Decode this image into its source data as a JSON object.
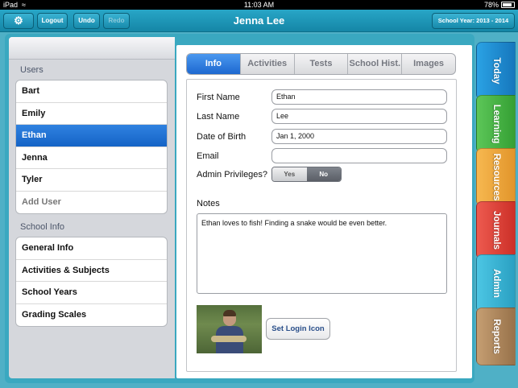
{
  "status_bar": {
    "carrier": "iPad",
    "time": "11:03 AM",
    "battery": "78%"
  },
  "nav": {
    "logout": "Logout",
    "undo": "Undo",
    "redo": "Redo",
    "title": "Jenna Lee",
    "school_year": "School Year: 2013 - 2014"
  },
  "users": {
    "label": "Users",
    "items": [
      "Bart",
      "Emily",
      "Ethan",
      "Jenna",
      "Tyler"
    ],
    "selected": "Ethan",
    "add_user": "Add User"
  },
  "school_info": {
    "label": "School Info",
    "items": [
      "General Info",
      "Activities & Subjects",
      "School Years",
      "Grading Scales"
    ]
  },
  "tabs": [
    "Info",
    "Activities",
    "Tests",
    "School Hist.",
    "Images"
  ],
  "form": {
    "first_name_label": "First Name",
    "first_name": "Ethan",
    "last_name_label": "Last Name",
    "last_name": "Lee",
    "dob_label": "Date of Birth",
    "dob": "Jan 1, 2000",
    "email_label": "Email",
    "email": "",
    "admin_label": "Admin Privileges?",
    "admin_yes": "Yes",
    "admin_no": "No",
    "admin_selected": "No",
    "notes_label": "Notes",
    "notes": "Ethan loves to fish! Finding a snake would be even better.",
    "set_login_icon": "Set Login Icon"
  },
  "side_tabs": [
    {
      "label": "Today",
      "color": "#1c8ed4"
    },
    {
      "label": "Learning",
      "color": "#4cb848"
    },
    {
      "label": "Resources",
      "color": "#f2a93b"
    },
    {
      "label": "Journals",
      "color": "#e4463c"
    },
    {
      "label": "Admin",
      "color": "#3ab8d8"
    },
    {
      "label": "Reports",
      "color": "#b08a5e"
    }
  ]
}
